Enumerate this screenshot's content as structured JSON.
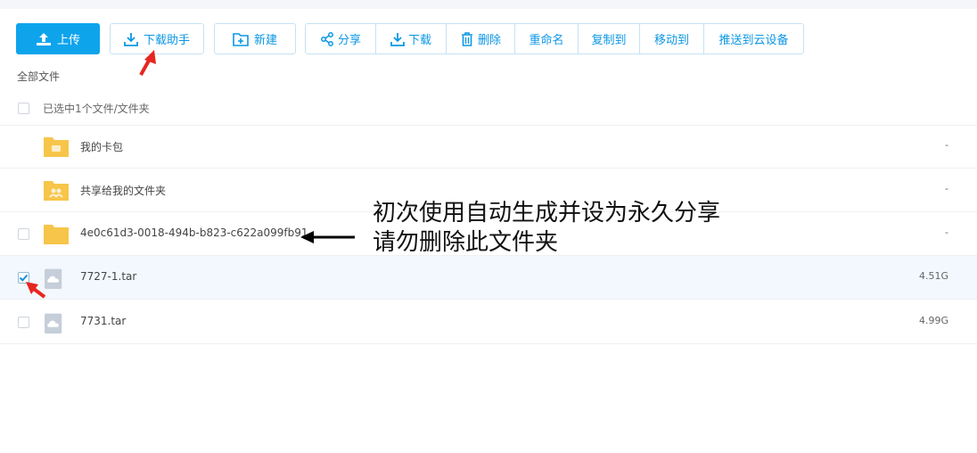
{
  "toolbar": {
    "upload_label": "上传",
    "download_helper_label": "下载助手",
    "new_label": "新建",
    "share_label": "分享",
    "download_label": "下载",
    "delete_label": "删除",
    "rename_label": "重命名",
    "copy_to_label": "复制到",
    "move_to_label": "移动到",
    "push_to_device_label": "推送到云设备"
  },
  "breadcrumb": "全部文件",
  "selection_text": "已选中1个文件/文件夹",
  "files": [
    {
      "name": "我的卡包",
      "size": "-",
      "icon": "folder-card-icon",
      "checked": false,
      "checkbox": false
    },
    {
      "name": "共享给我的文件夹",
      "size": "-",
      "icon": "folder-shared-icon",
      "checked": false,
      "checkbox": false
    },
    {
      "name": "4e0c61d3-0018-494b-b823-c622a099fb91",
      "size": "-",
      "icon": "folder-icon",
      "checked": false,
      "checkbox": true
    },
    {
      "name": "7727-1.tar",
      "size": "4.51G",
      "icon": "cloud-file-icon",
      "checked": true,
      "checkbox": true
    },
    {
      "name": "7731.tar",
      "size": "4.99G",
      "icon": "cloud-file-icon",
      "checked": false,
      "checkbox": true
    }
  ],
  "annotation": {
    "line1": "初次使用自动生成并设为永久分享",
    "line2": "请勿删除此文件夹"
  },
  "colors": {
    "accent": "#0ea4ec",
    "folder": "#f7c54a",
    "arrow_red": "#e8251f",
    "selected_row": "#f2f8fd"
  }
}
